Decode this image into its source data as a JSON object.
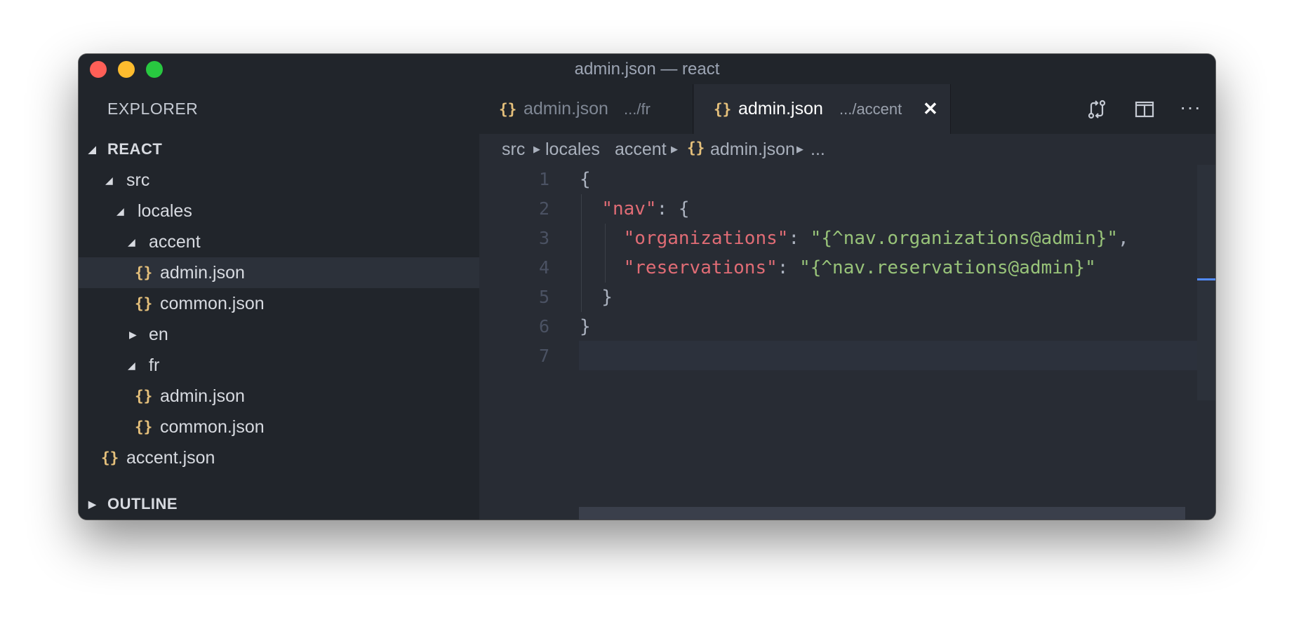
{
  "window": {
    "title": "admin.json — react"
  },
  "sidebar": {
    "explorer_label": "EXPLORER",
    "project_label": "REACT",
    "outline_label": "OUTLINE",
    "tree": [
      {
        "name": "src",
        "type": "folder",
        "expanded": true
      },
      {
        "name": "locales",
        "type": "folder",
        "expanded": true
      },
      {
        "name": "accent",
        "type": "folder",
        "expanded": true
      },
      {
        "name": "admin.json",
        "type": "file",
        "selected": true
      },
      {
        "name": "common.json",
        "type": "file"
      },
      {
        "name": "en",
        "type": "folder",
        "expanded": false
      },
      {
        "name": "fr",
        "type": "folder",
        "expanded": true
      },
      {
        "name": "admin.json",
        "type": "file"
      },
      {
        "name": "common.json",
        "type": "file"
      },
      {
        "name": "accent.json",
        "type": "file"
      }
    ]
  },
  "tabs": [
    {
      "name": "admin.json",
      "path": ".../fr",
      "active": false
    },
    {
      "name": "admin.json",
      "path": ".../accent",
      "active": true
    }
  ],
  "tab_actions": {
    "git_icon": "git-compare-icon",
    "split_icon": "split-editor-icon",
    "more_icon": "more-actions-icon",
    "more_glyph": "···"
  },
  "breadcrumb": {
    "items": [
      "src",
      "locales",
      "accent",
      "admin.json",
      "..."
    ],
    "file_icon_glyph": "{}"
  },
  "editor": {
    "line_numbers": [
      "1",
      "2",
      "3",
      "4",
      "5",
      "6",
      "7"
    ],
    "active_line": 7
  },
  "icons": {
    "json_glyph": "{}",
    "close_glyph": "✕",
    "collapsed_glyph": "▶",
    "expanded_glyph": "◢"
  },
  "colors": {
    "background": "#282c34",
    "sidebar": "#21252b",
    "json_icon": "#e5c07b",
    "key": "#e06c75",
    "string": "#98c379",
    "accent": "#528bff"
  }
}
